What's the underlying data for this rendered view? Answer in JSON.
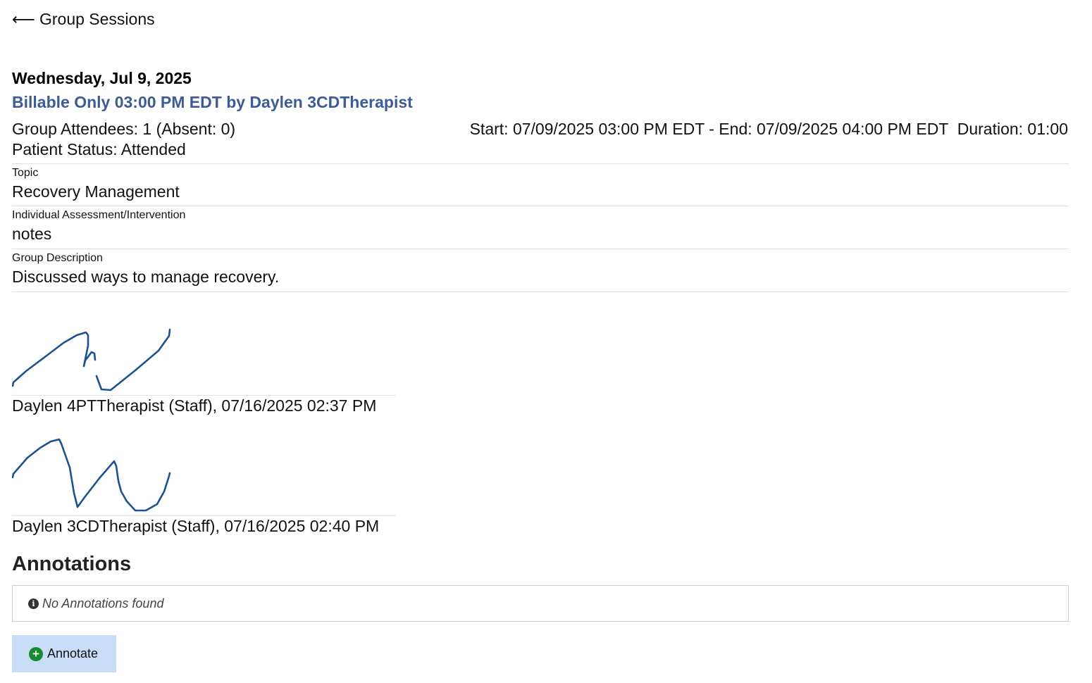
{
  "nav": {
    "back_arrow": "⟵",
    "back_label": "Group Sessions"
  },
  "session": {
    "date": "Wednesday, Jul 9, 2025",
    "title": "Billable Only 03:00 PM EDT by Daylen 3CDTherapist",
    "attendees": "Group Attendees: 1 (Absent: 0)",
    "timing": "Start: 07/09/2025 03:00 PM EDT - End: 07/09/2025 04:00 PM EDT  Duration: 01:00",
    "patient_status": "Patient Status: Attended",
    "title_color": "#3d5a99"
  },
  "fields": [
    {
      "label": "Topic",
      "value": "Recovery Management"
    },
    {
      "label": "Individual Assessment/Intervention",
      "value": "notes"
    },
    {
      "label": "Group Description",
      "value": "Discussed ways to manage recovery."
    }
  ],
  "signatures": [
    {
      "caption": "Daylen 4PTTherapist (Staff), 07/16/2025 02:37 PM"
    },
    {
      "caption": "Daylen 3CDTherapist (Staff), 07/16/2025 02:40 PM"
    }
  ],
  "annotations": {
    "heading": "Annotations",
    "empty_icon": "info-icon",
    "empty_message": "No Annotations found",
    "button_icon": "plus-circle-icon",
    "button_label": "Annotate",
    "button_color": "#c9dcf8",
    "plus_color": "#168a2e"
  }
}
